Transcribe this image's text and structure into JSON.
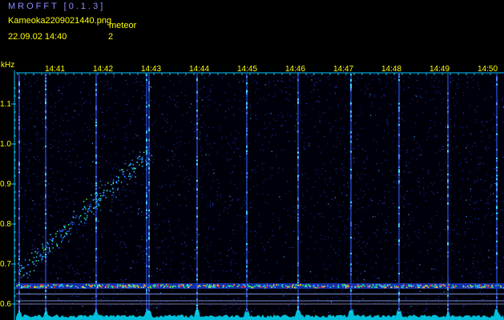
{
  "header": {
    "app_title": "MROFFT [0.1.3]",
    "file_name": "Kameoka2209021440.png",
    "meteor_label": "meteor",
    "date_time": "22.09.02  14:40",
    "meteor_count": "2"
  },
  "chart_data": {
    "type": "heatmap",
    "ylabel": "kHz",
    "y_ticks": [
      "1.1",
      "1.0",
      "0.9",
      "0.8",
      "0.7",
      "0.6"
    ],
    "x_ticks": [
      "14:41",
      "14:42",
      "14:43",
      "14:44",
      "14:45",
      "14:46",
      "14:47",
      "14:48",
      "14:49",
      "14:50"
    ],
    "colors": {
      "background": "#000000",
      "noise": "#1a2fa8",
      "text": "#ffff00",
      "axis": "#00c8ff",
      "carrier": "#ff4040",
      "title": "#8c8cff"
    }
  }
}
